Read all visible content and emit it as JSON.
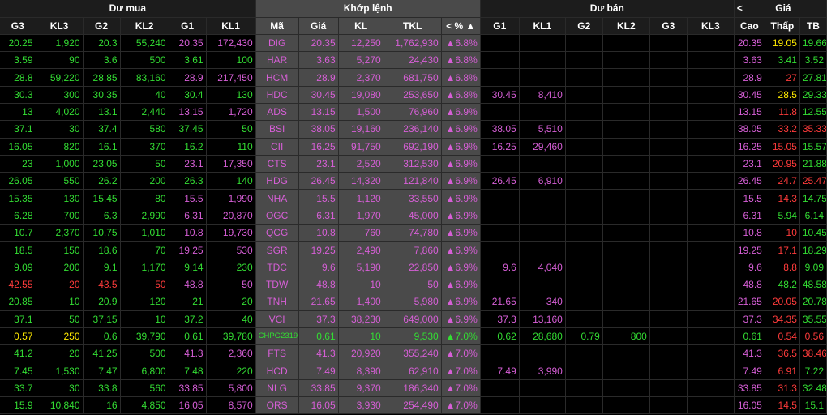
{
  "groups": {
    "buy": "Dư mua",
    "match": "Khớp lệnh",
    "sell": "Dư bán",
    "price": "Giá",
    "price_prev_arrow": "<"
  },
  "headers": [
    "G3",
    "KL3",
    "G2",
    "KL2",
    "G1",
    "KL1",
    "Mã",
    "Giá",
    "KL",
    "TKL",
    "%",
    "G1",
    "KL1",
    "G2",
    "KL2",
    "G3",
    "KL3",
    "Cao",
    "Thấp",
    "TB"
  ],
  "pct_header_left": "<",
  "pct_header_right": "▲",
  "colors": {
    "up": "#33dd33",
    "ceiling": "#d75fd7",
    "ref": "#ffea00",
    "down": "#ff3b3b",
    "neutral": "#ffffff"
  },
  "rows": [
    {
      "cells": [
        "20.25",
        "1,920",
        "20.3",
        "55,240",
        "20.35",
        "172,430",
        "DIG",
        "20.35",
        "12,250",
        "1,762,930",
        "▲6.8%",
        "",
        "",
        "",
        "",
        "",
        "",
        "20.35",
        "19.05",
        "19.66"
      ],
      "colors": [
        "g",
        "g",
        "g",
        "g",
        "m",
        "m",
        "m",
        "m",
        "m",
        "m",
        "m",
        "",
        "",
        "",
        "",
        "",
        "",
        "m",
        "y",
        "g"
      ]
    },
    {
      "cells": [
        "3.59",
        "90",
        "3.6",
        "500",
        "3.61",
        "100",
        "HAR",
        "3.63",
        "5,270",
        "24,430",
        "▲6.8%",
        "",
        "",
        "",
        "",
        "",
        "",
        "3.63",
        "3.41",
        "3.52"
      ],
      "colors": [
        "g",
        "g",
        "g",
        "g",
        "g",
        "g",
        "m",
        "m",
        "m",
        "m",
        "m",
        "",
        "",
        "",
        "",
        "",
        "",
        "m",
        "g",
        "g"
      ]
    },
    {
      "cells": [
        "28.8",
        "59,220",
        "28.85",
        "83,160",
        "28.9",
        "217,450",
        "HCM",
        "28.9",
        "2,370",
        "681,750",
        "▲6.8%",
        "",
        "",
        "",
        "",
        "",
        "",
        "28.9",
        "27",
        "27.81"
      ],
      "colors": [
        "g",
        "g",
        "g",
        "g",
        "m",
        "m",
        "m",
        "m",
        "m",
        "m",
        "m",
        "",
        "",
        "",
        "",
        "",
        "",
        "m",
        "r",
        "g"
      ]
    },
    {
      "cells": [
        "30.3",
        "300",
        "30.35",
        "40",
        "30.4",
        "130",
        "HDC",
        "30.45",
        "19,080",
        "253,650",
        "▲6.8%",
        "30.45",
        "8,410",
        "",
        "",
        "",
        "",
        "30.45",
        "28.5",
        "29.33"
      ],
      "colors": [
        "g",
        "g",
        "g",
        "g",
        "g",
        "g",
        "m",
        "m",
        "m",
        "m",
        "m",
        "m",
        "m",
        "",
        "",
        "",
        "",
        "m",
        "y",
        "g"
      ]
    },
    {
      "cells": [
        "13",
        "4,020",
        "13.1",
        "2,440",
        "13.15",
        "1,720",
        "ADS",
        "13.15",
        "1,500",
        "76,960",
        "▲6.9%",
        "",
        "",
        "",
        "",
        "",
        "",
        "13.15",
        "11.8",
        "12.55"
      ],
      "colors": [
        "g",
        "g",
        "g",
        "g",
        "m",
        "m",
        "m",
        "m",
        "m",
        "m",
        "m",
        "",
        "",
        "",
        "",
        "",
        "",
        "m",
        "r",
        "g"
      ]
    },
    {
      "cells": [
        "37.1",
        "30",
        "37.4",
        "580",
        "37.45",
        "50",
        "BSI",
        "38.05",
        "19,160",
        "236,140",
        "▲6.9%",
        "38.05",
        "5,510",
        "",
        "",
        "",
        "",
        "38.05",
        "33.2",
        "35.33"
      ],
      "colors": [
        "g",
        "g",
        "g",
        "g",
        "g",
        "g",
        "m",
        "m",
        "m",
        "m",
        "m",
        "m",
        "m",
        "",
        "",
        "",
        "",
        "m",
        "r",
        "r"
      ]
    },
    {
      "cells": [
        "16.05",
        "820",
        "16.1",
        "370",
        "16.2",
        "110",
        "CII",
        "16.25",
        "91,750",
        "692,190",
        "▲6.9%",
        "16.25",
        "29,460",
        "",
        "",
        "",
        "",
        "16.25",
        "15.05",
        "15.57"
      ],
      "colors": [
        "g",
        "g",
        "g",
        "g",
        "g",
        "g",
        "m",
        "m",
        "m",
        "m",
        "m",
        "m",
        "m",
        "",
        "",
        "",
        "",
        "m",
        "r",
        "g"
      ]
    },
    {
      "cells": [
        "23",
        "1,000",
        "23.05",
        "50",
        "23.1",
        "17,350",
        "CTS",
        "23.1",
        "2,520",
        "312,530",
        "▲6.9%",
        "",
        "",
        "",
        "",
        "",
        "",
        "23.1",
        "20.95",
        "21.88"
      ],
      "colors": [
        "g",
        "g",
        "g",
        "g",
        "m",
        "m",
        "m",
        "m",
        "m",
        "m",
        "m",
        "",
        "",
        "",
        "",
        "",
        "",
        "m",
        "r",
        "g"
      ]
    },
    {
      "cells": [
        "26.05",
        "550",
        "26.2",
        "200",
        "26.3",
        "140",
        "HDG",
        "26.45",
        "14,320",
        "121,840",
        "▲6.9%",
        "26.45",
        "6,910",
        "",
        "",
        "",
        "",
        "26.45",
        "24.7",
        "25.47"
      ],
      "colors": [
        "g",
        "g",
        "g",
        "g",
        "g",
        "g",
        "m",
        "m",
        "m",
        "m",
        "m",
        "m",
        "m",
        "",
        "",
        "",
        "",
        "m",
        "r",
        "r"
      ]
    },
    {
      "cells": [
        "15.35",
        "130",
        "15.45",
        "80",
        "15.5",
        "1,990",
        "NHA",
        "15.5",
        "1,120",
        "33,550",
        "▲6.9%",
        "",
        "",
        "",
        "",
        "",
        "",
        "15.5",
        "14.3",
        "14.75"
      ],
      "colors": [
        "g",
        "g",
        "g",
        "g",
        "m",
        "m",
        "m",
        "m",
        "m",
        "m",
        "m",
        "",
        "",
        "",
        "",
        "",
        "",
        "m",
        "r",
        "g"
      ]
    },
    {
      "cells": [
        "6.28",
        "700",
        "6.3",
        "2,990",
        "6.31",
        "20,870",
        "OGC",
        "6.31",
        "1,970",
        "45,000",
        "▲6.9%",
        "",
        "",
        "",
        "",
        "",
        "",
        "6.31",
        "5.94",
        "6.14"
      ],
      "colors": [
        "g",
        "g",
        "g",
        "g",
        "m",
        "m",
        "m",
        "m",
        "m",
        "m",
        "m",
        "",
        "",
        "",
        "",
        "",
        "",
        "m",
        "g",
        "g"
      ]
    },
    {
      "cells": [
        "10.7",
        "2,370",
        "10.75",
        "1,010",
        "10.8",
        "19,730",
        "QCG",
        "10.8",
        "760",
        "74,780",
        "▲6.9%",
        "",
        "",
        "",
        "",
        "",
        "",
        "10.8",
        "10",
        "10.45"
      ],
      "colors": [
        "g",
        "g",
        "g",
        "g",
        "m",
        "m",
        "m",
        "m",
        "m",
        "m",
        "m",
        "",
        "",
        "",
        "",
        "",
        "",
        "m",
        "r",
        "g"
      ]
    },
    {
      "cells": [
        "18.5",
        "150",
        "18.6",
        "70",
        "19.25",
        "530",
        "SGR",
        "19.25",
        "2,490",
        "7,860",
        "▲6.9%",
        "",
        "",
        "",
        "",
        "",
        "",
        "19.25",
        "17.1",
        "18.29"
      ],
      "colors": [
        "g",
        "g",
        "g",
        "g",
        "m",
        "m",
        "m",
        "m",
        "m",
        "m",
        "m",
        "",
        "",
        "",
        "",
        "",
        "",
        "m",
        "r",
        "g"
      ]
    },
    {
      "cells": [
        "9.09",
        "200",
        "9.1",
        "1,170",
        "9.14",
        "230",
        "TDC",
        "9.6",
        "5,190",
        "22,850",
        "▲6.9%",
        "9.6",
        "4,040",
        "",
        "",
        "",
        "",
        "9.6",
        "8.8",
        "9.09"
      ],
      "colors": [
        "g",
        "g",
        "g",
        "g",
        "g",
        "g",
        "m",
        "m",
        "m",
        "m",
        "m",
        "m",
        "m",
        "",
        "",
        "",
        "",
        "m",
        "r",
        "g"
      ]
    },
    {
      "cells": [
        "42.55",
        "20",
        "43.5",
        "50",
        "48.8",
        "50",
        "TDW",
        "48.8",
        "10",
        "50",
        "▲6.9%",
        "",
        "",
        "",
        "",
        "",
        "",
        "48.8",
        "48.2",
        "48.58"
      ],
      "colors": [
        "r",
        "r",
        "r",
        "r",
        "m",
        "m",
        "m",
        "m",
        "m",
        "m",
        "m",
        "",
        "",
        "",
        "",
        "",
        "",
        "m",
        "g",
        "g"
      ]
    },
    {
      "cells": [
        "20.85",
        "10",
        "20.9",
        "120",
        "21",
        "20",
        "TNH",
        "21.65",
        "1,400",
        "5,980",
        "▲6.9%",
        "21.65",
        "340",
        "",
        "",
        "",
        "",
        "21.65",
        "20.05",
        "20.78"
      ],
      "colors": [
        "g",
        "g",
        "g",
        "g",
        "g",
        "g",
        "m",
        "m",
        "m",
        "m",
        "m",
        "m",
        "m",
        "",
        "",
        "",
        "",
        "m",
        "r",
        "g"
      ]
    },
    {
      "cells": [
        "37.1",
        "50",
        "37.15",
        "10",
        "37.2",
        "40",
        "VCI",
        "37.3",
        "38,230",
        "649,000",
        "▲6.9%",
        "37.3",
        "13,160",
        "",
        "",
        "",
        "",
        "37.3",
        "34.35",
        "35.55"
      ],
      "colors": [
        "g",
        "g",
        "g",
        "g",
        "g",
        "g",
        "m",
        "m",
        "m",
        "m",
        "m",
        "m",
        "m",
        "",
        "",
        "",
        "",
        "m",
        "r",
        "g"
      ]
    },
    {
      "cells": [
        "0.57",
        "250",
        "0.6",
        "39,790",
        "0.61",
        "39,780",
        "CHPG2319",
        "0.61",
        "10",
        "9,530",
        "▲7.0%",
        "0.62",
        "28,680",
        "0.79",
        "800",
        "",
        "",
        "0.61",
        "0.54",
        "0.56"
      ],
      "colors": [
        "y",
        "y",
        "g",
        "g",
        "g",
        "g",
        "g",
        "g",
        "g",
        "g",
        "g",
        "g",
        "g",
        "g",
        "g",
        "",
        "",
        "g",
        "r",
        "r"
      ]
    },
    {
      "cells": [
        "41.2",
        "20",
        "41.25",
        "500",
        "41.3",
        "2,360",
        "FTS",
        "41.3",
        "20,920",
        "355,240",
        "▲7.0%",
        "",
        "",
        "",
        "",
        "",
        "",
        "41.3",
        "36.5",
        "38.46"
      ],
      "colors": [
        "g",
        "g",
        "g",
        "g",
        "m",
        "m",
        "m",
        "m",
        "m",
        "m",
        "m",
        "",
        "",
        "",
        "",
        "",
        "",
        "m",
        "r",
        "r"
      ]
    },
    {
      "cells": [
        "7.45",
        "1,530",
        "7.47",
        "6,800",
        "7.48",
        "220",
        "HCD",
        "7.49",
        "8,390",
        "62,910",
        "▲7.0%",
        "7.49",
        "3,990",
        "",
        "",
        "",
        "",
        "7.49",
        "6.91",
        "7.22"
      ],
      "colors": [
        "g",
        "g",
        "g",
        "g",
        "g",
        "g",
        "m",
        "m",
        "m",
        "m",
        "m",
        "m",
        "m",
        "",
        "",
        "",
        "",
        "m",
        "r",
        "g"
      ]
    },
    {
      "cells": [
        "33.7",
        "30",
        "33.8",
        "560",
        "33.85",
        "5,800",
        "NLG",
        "33.85",
        "9,370",
        "186,340",
        "▲7.0%",
        "",
        "",
        "",
        "",
        "",
        "",
        "33.85",
        "31.3",
        "32.48"
      ],
      "colors": [
        "g",
        "g",
        "g",
        "g",
        "m",
        "m",
        "m",
        "m",
        "m",
        "m",
        "m",
        "",
        "",
        "",
        "",
        "",
        "",
        "m",
        "r",
        "g"
      ]
    },
    {
      "cells": [
        "15.9",
        "10,840",
        "16",
        "4,850",
        "16.05",
        "8,570",
        "ORS",
        "16.05",
        "3,930",
        "254,490",
        "▲7.0%",
        "",
        "",
        "",
        "",
        "",
        "",
        "16.05",
        "14.5",
        "15.1"
      ],
      "colors": [
        "g",
        "g",
        "g",
        "g",
        "m",
        "m",
        "m",
        "m",
        "m",
        "m",
        "m",
        "",
        "",
        "",
        "",
        "",
        "",
        "m",
        "r",
        "g"
      ]
    }
  ]
}
